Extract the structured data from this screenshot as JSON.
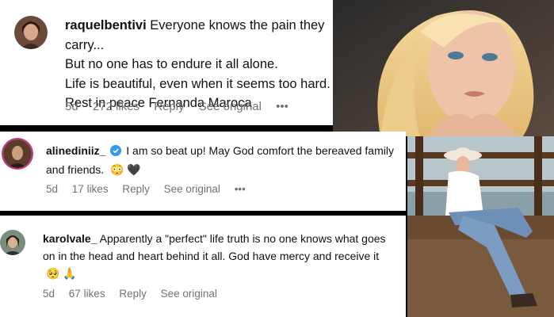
{
  "comments": [
    {
      "username": "raquelbentivi",
      "lines": [
        "Everyone knows the pain they carry...",
        "But no one has to endure it all alone.",
        "Life is beautiful, even when it seems too hard.",
        "Rest in peace Fernanda Maroca"
      ],
      "emoji": "💔",
      "age": "5d",
      "likes": "272 likes",
      "reply": "Reply",
      "see_original": "See original",
      "more": "•••"
    },
    {
      "username": "alinediniiz_",
      "verified": true,
      "text": "I am so beat up! May God comfort the bereaved family and friends.",
      "emojis": "😳 🖤",
      "age": "5d",
      "likes": "17 likes",
      "reply": "Reply",
      "see_original": "See original",
      "more": "•••"
    },
    {
      "username": "karolvale_",
      "text": "Apparently a \"perfect\" life truth is no one knows what goes on in the head and heart behind it all. God have mercy and receive it",
      "emojis": "🥺 🙏",
      "age": "5d",
      "likes": "67 likes",
      "reply": "Reply",
      "see_original": "See original"
    }
  ],
  "colors": {
    "verified_blue": "#3897f0",
    "meta_gray": "#737373",
    "story_ring": "#c13584"
  }
}
